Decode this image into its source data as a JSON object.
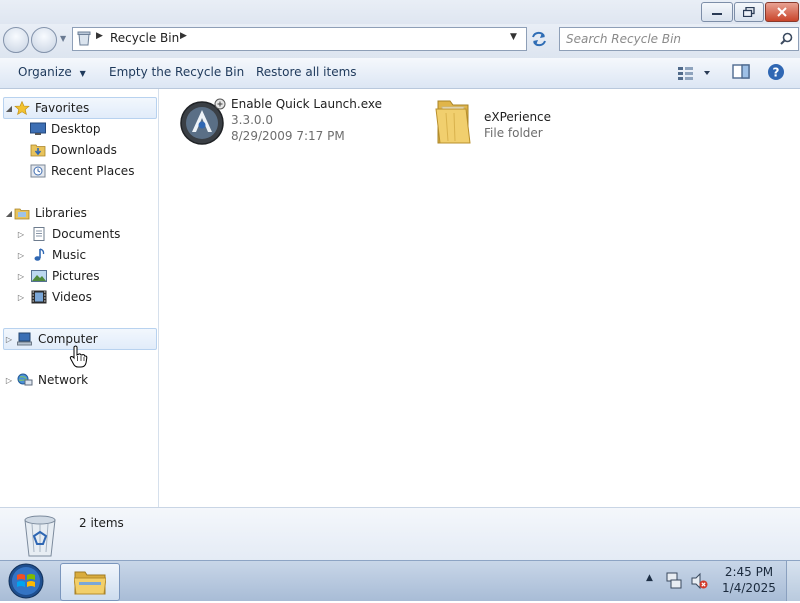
{
  "window": {
    "address": {
      "segments": [
        "Recycle Bin"
      ]
    },
    "search": {
      "placeholder": "Search Recycle Bin"
    }
  },
  "toolbar": {
    "organize": "Organize",
    "empty_recycle_bin": "Empty the Recycle Bin",
    "restore_all": "Restore all items"
  },
  "navpane": {
    "favorites": {
      "label": "Favorites",
      "items": [
        "Desktop",
        "Downloads",
        "Recent Places"
      ]
    },
    "libraries": {
      "label": "Libraries",
      "items": [
        "Documents",
        "Music",
        "Pictures",
        "Videos"
      ]
    },
    "computer": "Computer",
    "network": "Network"
  },
  "files": [
    {
      "name": "Enable Quick Launch.exe",
      "line2": "3.3.0.0",
      "line3": "8/29/2009 7:17 PM",
      "icon": "exe-app-icon"
    },
    {
      "name": "eXPerience",
      "line2": "File folder",
      "icon": "folder-icon"
    }
  ],
  "details": {
    "count_text": "2 items"
  },
  "taskbar": {
    "time": "2:45 PM",
    "date": "1/4/2025"
  },
  "colors": {
    "accent": "#1e395b",
    "selection": "#e1ecfa",
    "taskbar": "#b6c7dd",
    "close": "#c9452b"
  }
}
